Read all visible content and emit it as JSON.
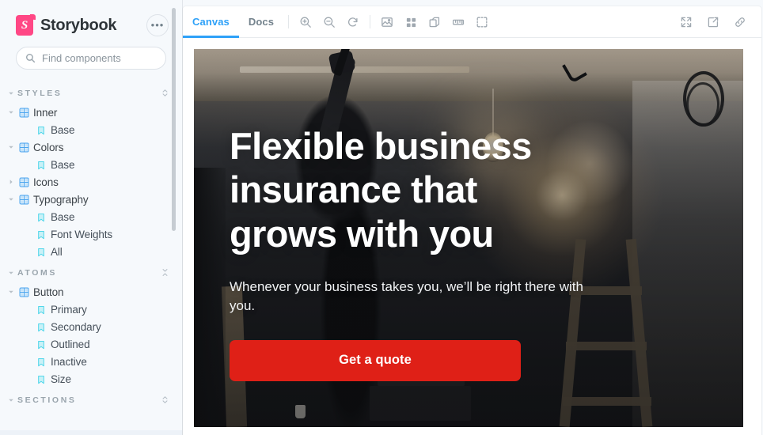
{
  "app": {
    "brand": "Storybook",
    "logo_color": "#FF4785",
    "logo_letter": "S"
  },
  "sidebar": {
    "more_button_label": "•••",
    "search": {
      "placeholder": "Find components",
      "value": "",
      "shortcut": "/"
    },
    "sections": [
      {
        "title": "STYLES",
        "action": "expand-collapse-icon",
        "items": [
          {
            "label": "Inner",
            "type": "component",
            "level": 1,
            "expanded": true
          },
          {
            "label": "Base",
            "type": "story",
            "level": 2
          },
          {
            "label": "Colors",
            "type": "component",
            "level": 1,
            "expanded": true
          },
          {
            "label": "Base",
            "type": "story",
            "level": 2
          },
          {
            "label": "Icons",
            "type": "component",
            "level": 1,
            "expanded": false
          },
          {
            "label": "Typography",
            "type": "component",
            "level": 1,
            "expanded": true
          },
          {
            "label": "Base",
            "type": "story",
            "level": 2
          },
          {
            "label": "Font Weights",
            "type": "story",
            "level": 2
          },
          {
            "label": "All",
            "type": "story",
            "level": 2
          }
        ]
      },
      {
        "title": "ATOMS",
        "action": "collapse-all-icon",
        "items": [
          {
            "label": "Button",
            "type": "component",
            "level": 1,
            "expanded": true
          },
          {
            "label": "Primary",
            "type": "story",
            "level": 2
          },
          {
            "label": "Secondary",
            "type": "story",
            "level": 2
          },
          {
            "label": "Outlined",
            "type": "story",
            "level": 2
          },
          {
            "label": "Inactive",
            "type": "story",
            "level": 2
          },
          {
            "label": "Size",
            "type": "story",
            "level": 2
          }
        ]
      },
      {
        "title": "SECTIONS",
        "action": "expand-collapse-icon",
        "items": []
      }
    ]
  },
  "toolbar": {
    "tabs": [
      {
        "label": "Canvas",
        "active": true
      },
      {
        "label": "Docs",
        "active": false
      }
    ],
    "active_tab_color": "#2EA1F8",
    "zoom_tools": [
      {
        "name": "zoom-in-icon",
        "title": "Zoom in"
      },
      {
        "name": "zoom-out-icon",
        "title": "Zoom out"
      },
      {
        "name": "zoom-reset-icon",
        "title": "Reset zoom"
      }
    ],
    "view_tools": [
      {
        "name": "background-icon",
        "title": "Change background"
      },
      {
        "name": "grid-icon",
        "title": "Apply grid"
      },
      {
        "name": "outline-icon",
        "title": "Apply outlines"
      },
      {
        "name": "measure-icon",
        "title": "Measure"
      },
      {
        "name": "selection-icon",
        "title": "Enable outline"
      }
    ],
    "right_tools": [
      {
        "name": "fullscreen-icon",
        "title": "Go full screen"
      },
      {
        "name": "open-new-tab-icon",
        "title": "Open canvas in new tab"
      },
      {
        "name": "copy-link-icon",
        "title": "Copy canvas link"
      }
    ]
  },
  "preview": {
    "hero": {
      "title": "Flexible business insurance that grows with you",
      "subtitle": "Whenever your business takes you, we’ll be right there with you.",
      "cta_label": "Get a quote",
      "cta_color": "#DF2017"
    }
  }
}
